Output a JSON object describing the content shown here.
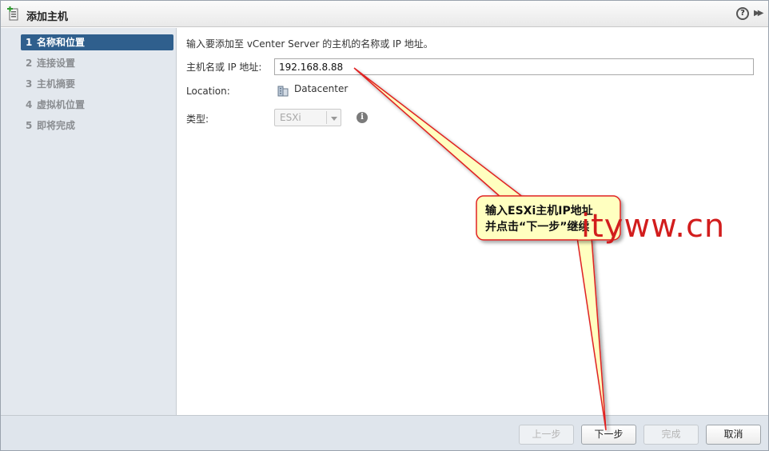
{
  "window": {
    "title": "添加主机"
  },
  "sidebar": {
    "steps": [
      {
        "num": "1",
        "label": "名称和位置"
      },
      {
        "num": "2",
        "label": "连接设置"
      },
      {
        "num": "3",
        "label": "主机摘要"
      },
      {
        "num": "4",
        "label": "虚拟机位置"
      },
      {
        "num": "5",
        "label": "即将完成"
      }
    ]
  },
  "content": {
    "intro": "输入要添加至 vCenter Server 的主机的名称或 IP 地址。",
    "host_label": "主机名或 IP 地址:",
    "host_value": "192.168.8.88",
    "location_label": "Location:",
    "location_value": "Datacenter",
    "type_label": "类型:",
    "type_value": "ESXi"
  },
  "footer": {
    "back_label": "上一步",
    "next_label": "下一步",
    "finish_label": "完成",
    "cancel_label": "取消"
  },
  "annotation": {
    "line1": "输入ESXi主机IP地址",
    "line2": "并点击“下一步”继续",
    "watermark": "ityww.cn"
  },
  "colors": {
    "active_step_bg": "#2f5f8d",
    "callout_fill": "#ffffc0",
    "callout_border": "#e02020",
    "watermark": "#d21d1d"
  }
}
